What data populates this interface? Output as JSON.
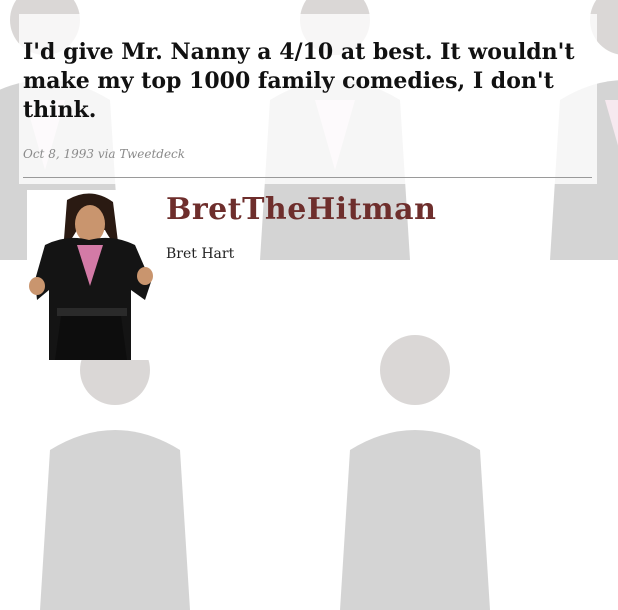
{
  "tweet": {
    "text": "I'd give Mr. Nanny a 4/10 at best. It wouldn't make my top 1000 family comedies, I don't think.",
    "meta": "Oct 8, 1993 via Tweetdeck"
  },
  "profile": {
    "screen_name": "BretTheHitman",
    "real_name": "Bret Hart",
    "avatar_icon": "wrestler-photo"
  },
  "background": {
    "icon": "wrestler-photo-tile"
  },
  "colors": {
    "screen_name": "#6e2e2c",
    "tweet_text": "#111111",
    "meta_text": "#8a8a8a"
  }
}
